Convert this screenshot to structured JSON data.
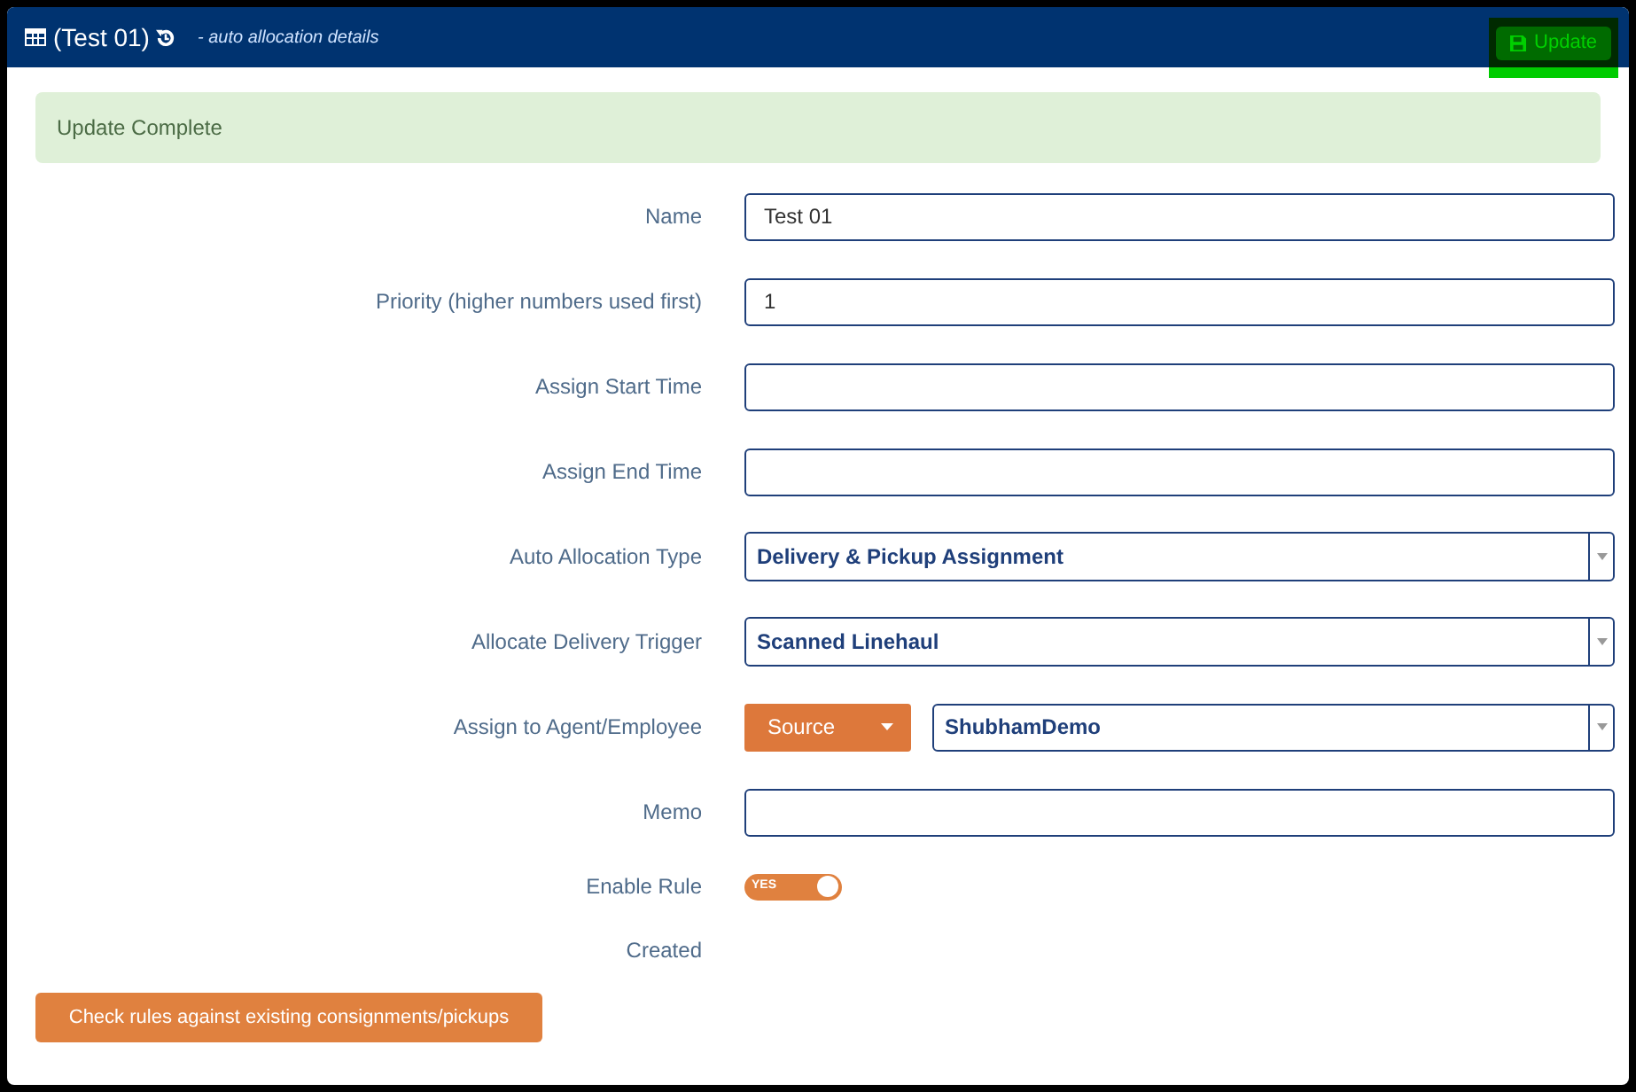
{
  "header": {
    "title": "(Test 01)",
    "subtitle": "- auto allocation details",
    "update_button": "Update"
  },
  "alert": "Update Complete",
  "fields": [
    {
      "kind": "text",
      "label": "Name",
      "value": "Test 01"
    },
    {
      "kind": "text",
      "label": "Priority (higher numbers used first)",
      "value": "1"
    },
    {
      "kind": "text",
      "label": "Assign Start Time"
    },
    {
      "kind": "text",
      "label": "Assign End Time"
    },
    {
      "kind": "select",
      "label": "Auto Allocation Type",
      "value": "Delivery & Pickup Assignment"
    },
    {
      "kind": "select",
      "label": "Allocate Delivery Trigger",
      "value": "Scanned Linehaul"
    },
    {
      "kind": "source-select",
      "label": "Assign to Agent/Employee",
      "source": "Source",
      "value": "ShubhamDemo"
    },
    {
      "kind": "text",
      "label": "Memo"
    },
    {
      "kind": "toggle",
      "label": "Enable Rule",
      "on": true,
      "on_text": "YES"
    },
    {
      "kind": "static",
      "label": "Created"
    }
  ],
  "check_button": "Check rules against existing consignments/pickups"
}
